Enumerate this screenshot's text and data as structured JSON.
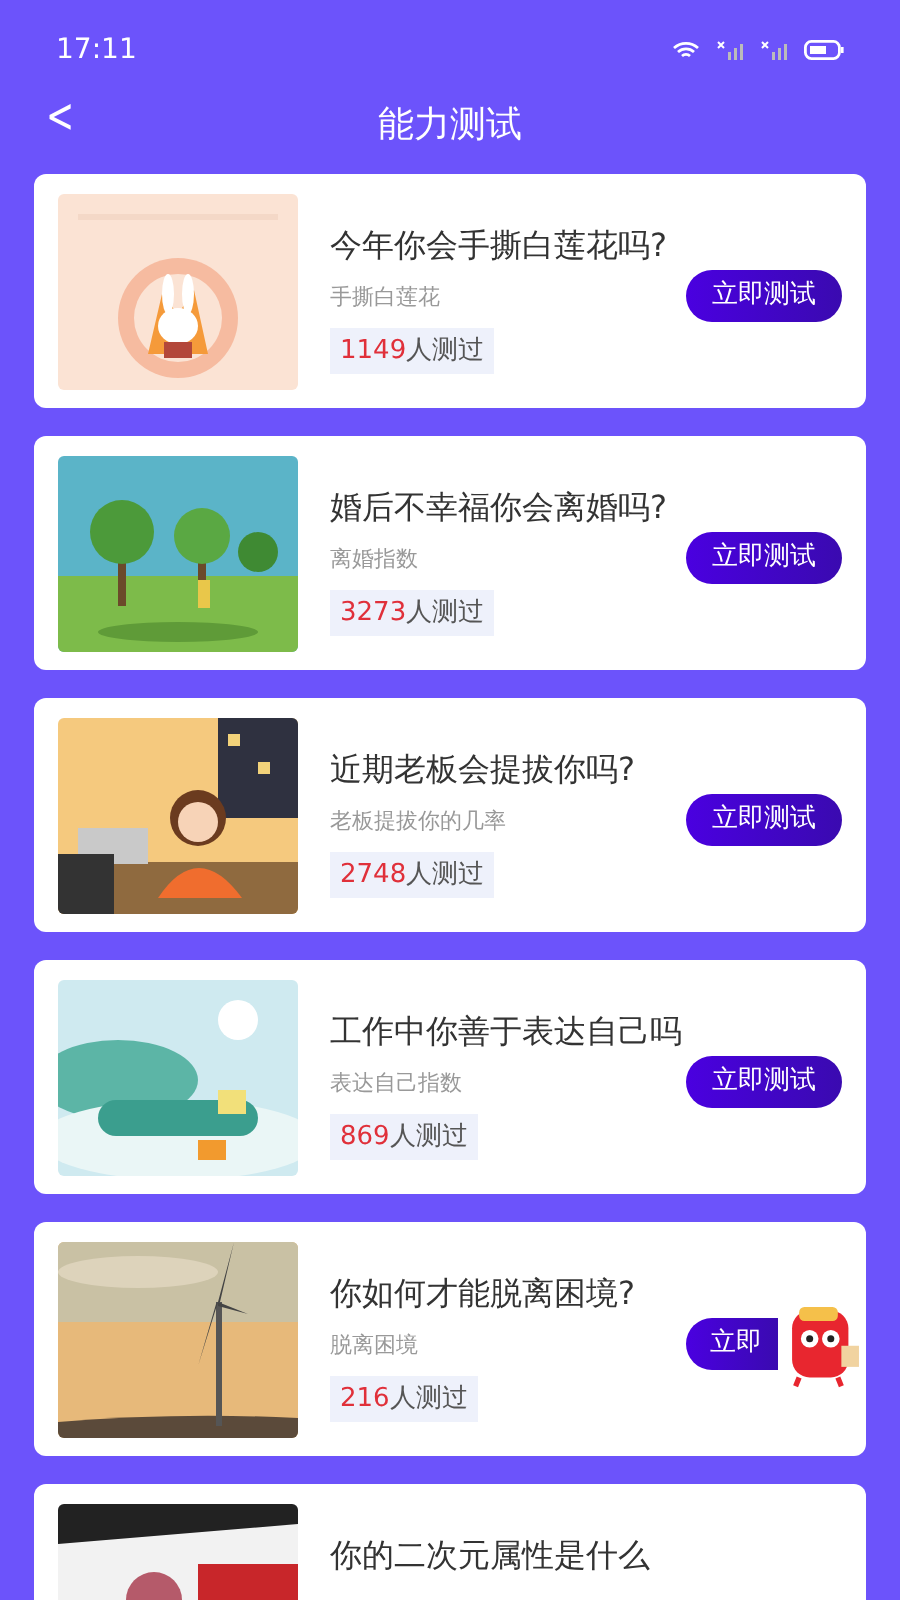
{
  "status_bar": {
    "time": "17:11"
  },
  "header": {
    "back": "<",
    "title": "能力测试"
  },
  "tests": [
    {
      "title": "今年你会手撕白莲花吗?",
      "subtitle": "手撕白莲花",
      "count": "1149",
      "count_suffix": "人测过",
      "button": "立即测试"
    },
    {
      "title": "婚后不幸福你会离婚吗?",
      "subtitle": "离婚指数",
      "count": "3273",
      "count_suffix": "人测过",
      "button": "立即测试"
    },
    {
      "title": "近期老板会提拔你吗?",
      "subtitle": "老板提拔你的几率",
      "count": "2748",
      "count_suffix": "人测过",
      "button": "立即测试"
    },
    {
      "title": "工作中你善于表达自己吗",
      "subtitle": "表达自己指数",
      "count": "869",
      "count_suffix": "人测过",
      "button": "立即测试"
    },
    {
      "title": "你如何才能脱离困境?",
      "subtitle": "脱离困境",
      "count": "216",
      "count_suffix": "人测过",
      "button": "立即",
      "mascot": true
    },
    {
      "title": "你的二次元属性是什么"
    }
  ]
}
